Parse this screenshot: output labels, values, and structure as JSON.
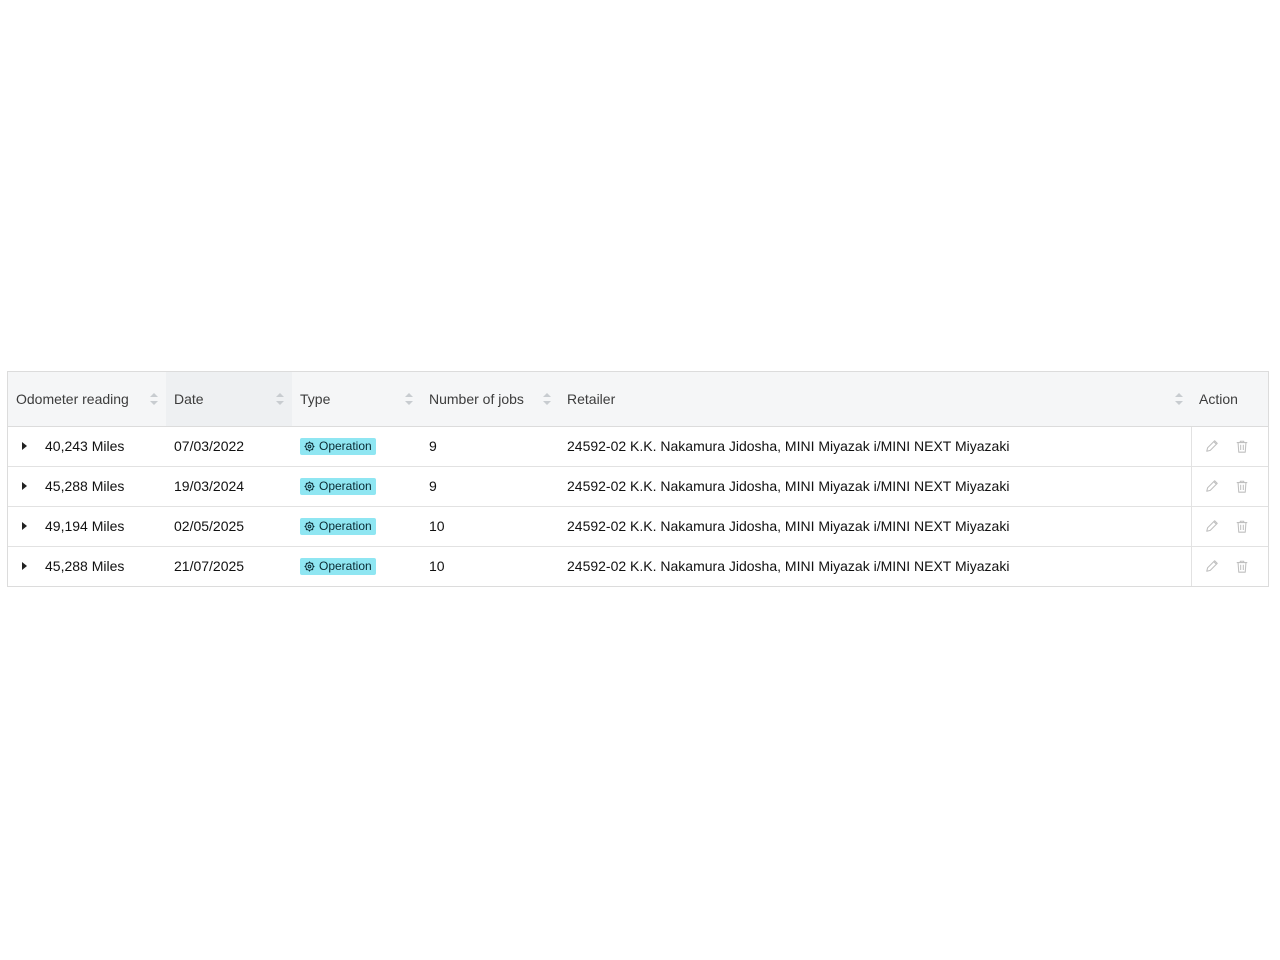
{
  "table": {
    "columns": [
      {
        "label": "Odometer reading",
        "sortable": true
      },
      {
        "label": "Date",
        "sortable": true
      },
      {
        "label": "Type",
        "sortable": true
      },
      {
        "label": "Number of jobs",
        "sortable": true
      },
      {
        "label": "Retailer",
        "sortable": true
      },
      {
        "label": "Action",
        "sortable": false
      }
    ],
    "rows": [
      {
        "odometer": "40,243 Miles",
        "date": "07/03/2022",
        "type": "Operation",
        "jobs": "9",
        "retailer": "24592-02 K.K. Nakamura Jidosha, MINI Miyazak i/MINI NEXT Miyazaki"
      },
      {
        "odometer": "45,288 Miles",
        "date": "19/03/2024",
        "type": "Operation",
        "jobs": "9",
        "retailer": "24592-02 K.K. Nakamura Jidosha, MINI Miyazak i/MINI NEXT Miyazaki"
      },
      {
        "odometer": "49,194 Miles",
        "date": "02/05/2025",
        "type": "Operation",
        "jobs": "10",
        "retailer": "24592-02 K.K. Nakamura Jidosha, MINI Miyazak i/MINI NEXT Miyazaki"
      },
      {
        "odometer": "45,288 Miles",
        "date": "21/07/2025",
        "type": "Operation",
        "jobs": "10",
        "retailer": "24592-02 K.K. Nakamura Jidosha, MINI Miyazak i/MINI NEXT Miyazaki"
      }
    ],
    "row_icons": {
      "expand": "caret-right-icon",
      "type_tag": "gear-icon",
      "edit": "pencil-icon",
      "delete": "trash-icon"
    },
    "colors": {
      "header_bg": "#f5f6f7",
      "tag_bg": "#8fe6f2",
      "border": "#dcdcdc",
      "icon_muted": "#bfbfbf"
    }
  }
}
